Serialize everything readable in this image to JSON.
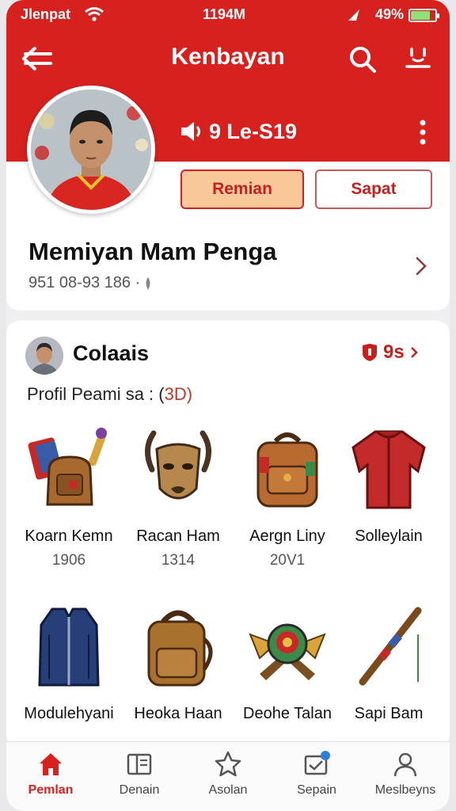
{
  "status": {
    "carrier": "Jlenpat",
    "time": "1194M",
    "battery": "49%"
  },
  "header": {
    "title": "Kenbayan"
  },
  "profile": {
    "volume_label": "9 Le-S19",
    "primary_button": "Remian",
    "secondary_button": "Sapat",
    "name": "Memiyan Mam Penga",
    "meta": "951 08-93 186 ·"
  },
  "collection": {
    "title": "Colaais",
    "badge": "9s",
    "subtitle_prefix": "Profil Peami sa : (",
    "subtitle_count": "3D",
    "subtitle_suffix": ")",
    "items": [
      {
        "name": "Koarn Kemn",
        "value": "1906",
        "icon": "backpack-cards-icon"
      },
      {
        "name": "Racan Ham",
        "value": "1314",
        "icon": "goat-mask-icon"
      },
      {
        "name": "Aergn Liny",
        "value": "20V1",
        "icon": "backpack-icon"
      },
      {
        "name": "Solleylain",
        "value": "",
        "icon": "red-jacket-icon"
      },
      {
        "name": "Modulehyani",
        "value": "",
        "icon": "blue-vest-icon"
      },
      {
        "name": "Heoka Haan",
        "value": "",
        "icon": "leather-backpack-icon"
      },
      {
        "name": "Deohe Talan",
        "value": "",
        "icon": "crest-emblem-icon"
      },
      {
        "name": "Sapi Bam",
        "value": "",
        "icon": "staff-icon"
      }
    ]
  },
  "nav": {
    "items": [
      {
        "label": "Pemlan",
        "icon": "home-icon"
      },
      {
        "label": "Denain",
        "icon": "book-icon"
      },
      {
        "label": "Asolan",
        "icon": "star-icon"
      },
      {
        "label": "Sepain",
        "icon": "inbox-icon"
      },
      {
        "label": "Meslbeyns",
        "icon": "profile-icon"
      }
    ]
  },
  "colors": {
    "brand": "#d7211f",
    "button_fill": "#f8c79a"
  }
}
